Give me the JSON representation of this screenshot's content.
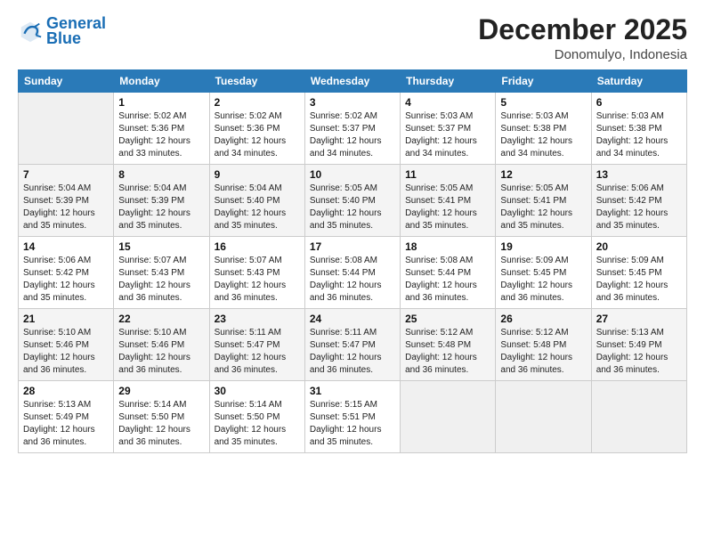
{
  "header": {
    "logo_line1": "General",
    "logo_line2": "Blue",
    "month": "December 2025",
    "location": "Donomulyo, Indonesia"
  },
  "columns": [
    "Sunday",
    "Monday",
    "Tuesday",
    "Wednesday",
    "Thursday",
    "Friday",
    "Saturday"
  ],
  "weeks": [
    [
      {
        "day": "",
        "info": ""
      },
      {
        "day": "1",
        "info": "Sunrise: 5:02 AM\nSunset: 5:36 PM\nDaylight: 12 hours\nand 33 minutes."
      },
      {
        "day": "2",
        "info": "Sunrise: 5:02 AM\nSunset: 5:36 PM\nDaylight: 12 hours\nand 34 minutes."
      },
      {
        "day": "3",
        "info": "Sunrise: 5:02 AM\nSunset: 5:37 PM\nDaylight: 12 hours\nand 34 minutes."
      },
      {
        "day": "4",
        "info": "Sunrise: 5:03 AM\nSunset: 5:37 PM\nDaylight: 12 hours\nand 34 minutes."
      },
      {
        "day": "5",
        "info": "Sunrise: 5:03 AM\nSunset: 5:38 PM\nDaylight: 12 hours\nand 34 minutes."
      },
      {
        "day": "6",
        "info": "Sunrise: 5:03 AM\nSunset: 5:38 PM\nDaylight: 12 hours\nand 34 minutes."
      }
    ],
    [
      {
        "day": "7",
        "info": "Sunrise: 5:04 AM\nSunset: 5:39 PM\nDaylight: 12 hours\nand 35 minutes."
      },
      {
        "day": "8",
        "info": "Sunrise: 5:04 AM\nSunset: 5:39 PM\nDaylight: 12 hours\nand 35 minutes."
      },
      {
        "day": "9",
        "info": "Sunrise: 5:04 AM\nSunset: 5:40 PM\nDaylight: 12 hours\nand 35 minutes."
      },
      {
        "day": "10",
        "info": "Sunrise: 5:05 AM\nSunset: 5:40 PM\nDaylight: 12 hours\nand 35 minutes."
      },
      {
        "day": "11",
        "info": "Sunrise: 5:05 AM\nSunset: 5:41 PM\nDaylight: 12 hours\nand 35 minutes."
      },
      {
        "day": "12",
        "info": "Sunrise: 5:05 AM\nSunset: 5:41 PM\nDaylight: 12 hours\nand 35 minutes."
      },
      {
        "day": "13",
        "info": "Sunrise: 5:06 AM\nSunset: 5:42 PM\nDaylight: 12 hours\nand 35 minutes."
      }
    ],
    [
      {
        "day": "14",
        "info": "Sunrise: 5:06 AM\nSunset: 5:42 PM\nDaylight: 12 hours\nand 35 minutes."
      },
      {
        "day": "15",
        "info": "Sunrise: 5:07 AM\nSunset: 5:43 PM\nDaylight: 12 hours\nand 36 minutes."
      },
      {
        "day": "16",
        "info": "Sunrise: 5:07 AM\nSunset: 5:43 PM\nDaylight: 12 hours\nand 36 minutes."
      },
      {
        "day": "17",
        "info": "Sunrise: 5:08 AM\nSunset: 5:44 PM\nDaylight: 12 hours\nand 36 minutes."
      },
      {
        "day": "18",
        "info": "Sunrise: 5:08 AM\nSunset: 5:44 PM\nDaylight: 12 hours\nand 36 minutes."
      },
      {
        "day": "19",
        "info": "Sunrise: 5:09 AM\nSunset: 5:45 PM\nDaylight: 12 hours\nand 36 minutes."
      },
      {
        "day": "20",
        "info": "Sunrise: 5:09 AM\nSunset: 5:45 PM\nDaylight: 12 hours\nand 36 minutes."
      }
    ],
    [
      {
        "day": "21",
        "info": "Sunrise: 5:10 AM\nSunset: 5:46 PM\nDaylight: 12 hours\nand 36 minutes."
      },
      {
        "day": "22",
        "info": "Sunrise: 5:10 AM\nSunset: 5:46 PM\nDaylight: 12 hours\nand 36 minutes."
      },
      {
        "day": "23",
        "info": "Sunrise: 5:11 AM\nSunset: 5:47 PM\nDaylight: 12 hours\nand 36 minutes."
      },
      {
        "day": "24",
        "info": "Sunrise: 5:11 AM\nSunset: 5:47 PM\nDaylight: 12 hours\nand 36 minutes."
      },
      {
        "day": "25",
        "info": "Sunrise: 5:12 AM\nSunset: 5:48 PM\nDaylight: 12 hours\nand 36 minutes."
      },
      {
        "day": "26",
        "info": "Sunrise: 5:12 AM\nSunset: 5:48 PM\nDaylight: 12 hours\nand 36 minutes."
      },
      {
        "day": "27",
        "info": "Sunrise: 5:13 AM\nSunset: 5:49 PM\nDaylight: 12 hours\nand 36 minutes."
      }
    ],
    [
      {
        "day": "28",
        "info": "Sunrise: 5:13 AM\nSunset: 5:49 PM\nDaylight: 12 hours\nand 36 minutes."
      },
      {
        "day": "29",
        "info": "Sunrise: 5:14 AM\nSunset: 5:50 PM\nDaylight: 12 hours\nand 36 minutes."
      },
      {
        "day": "30",
        "info": "Sunrise: 5:14 AM\nSunset: 5:50 PM\nDaylight: 12 hours\nand 35 minutes."
      },
      {
        "day": "31",
        "info": "Sunrise: 5:15 AM\nSunset: 5:51 PM\nDaylight: 12 hours\nand 35 minutes."
      },
      {
        "day": "",
        "info": ""
      },
      {
        "day": "",
        "info": ""
      },
      {
        "day": "",
        "info": ""
      }
    ]
  ]
}
